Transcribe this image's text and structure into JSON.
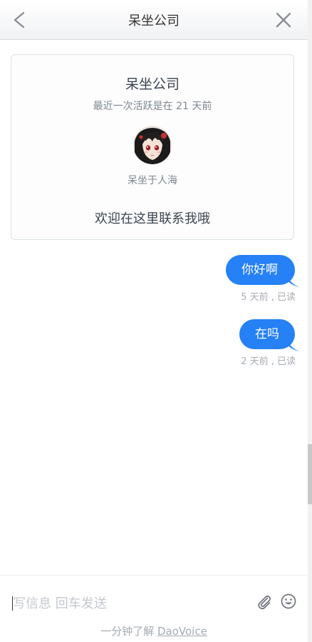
{
  "header": {
    "title": "呆坐公司",
    "back_icon": "chevron-left-icon",
    "close_icon": "close-icon"
  },
  "card": {
    "title": "呆坐公司",
    "last_active": "最近一次活跃是在 21 天前",
    "agent_name": "呆坐于人海",
    "welcome": "欢迎在这里联系我哦"
  },
  "messages": [
    {
      "text": "你好啊",
      "meta": "5 天前 , 已读"
    },
    {
      "text": "在吗",
      "meta": "2 天前 , 已读"
    }
  ],
  "input": {
    "placeholder": "写信息 回车发送",
    "value": "",
    "attach_icon": "paperclip-icon",
    "emoji_icon": "smiley-icon"
  },
  "footer": {
    "prefix": "一分钟了解 ",
    "link": "DaoVoice"
  },
  "colors": {
    "bubble": "#2781f6",
    "meta_text": "#a7adb5"
  }
}
